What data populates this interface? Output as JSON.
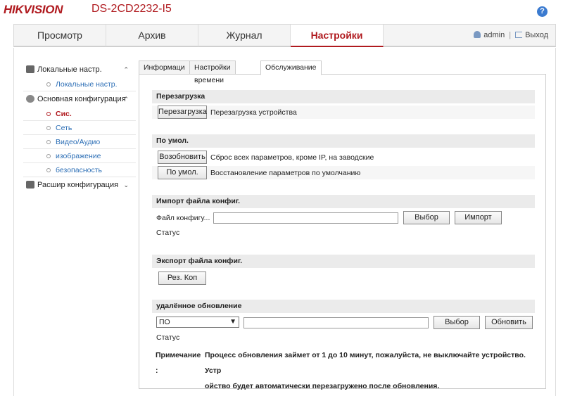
{
  "header": {
    "logo": "HIKVISION",
    "model": "DS-2CD2232-I5",
    "help": "?"
  },
  "nav": {
    "tabs": [
      "Просмотр",
      "Архив",
      "Журнал",
      "Настройки"
    ],
    "user": "admin",
    "logout": "Выход"
  },
  "sidebar": {
    "groups": [
      {
        "label": "Локальные настр.",
        "caret": "⌃",
        "items": [
          "Локальные настр."
        ]
      },
      {
        "label": "Основная конфигурация",
        "caret": "⌃",
        "items": [
          "Сис.",
          "Сеть",
          "Видео/Аудио",
          "изображение",
          "безопасность"
        ]
      },
      {
        "label": "Расшир конфигурация",
        "caret": "⌄"
      }
    ]
  },
  "tabs": [
    "Информаци",
    "Настройки времени",
    "Обслуживание"
  ],
  "reboot": {
    "title": "Перезагрузка",
    "button": "Перезагрузка",
    "desc": "Перезагрузка устройства"
  },
  "defaults": {
    "title": "По умол.",
    "restore_button": "Возобновить",
    "restore_desc": "Сброс всех параметров, кроме IP, на заводские",
    "default_button": "По умол.",
    "default_desc": "Восстановление параметров по умолчанию"
  },
  "import": {
    "title": "Импорт файла конфиг.",
    "file_label": "Файл конфигу...",
    "browse": "Выбор",
    "import_button": "Импорт",
    "status": "Статус"
  },
  "export": {
    "title": "Экспорт файла конфиг.",
    "button": "Рез. Коп"
  },
  "upgrade": {
    "title": "удалённое обновление",
    "select": "ПО",
    "browse": "Выбор",
    "upgrade_button": "Обновить",
    "status": "Статус",
    "note_label": "Примечание :",
    "note_line1": "Процесс обновления займет от 1 до 10 минут, пожалуйста, не выключайте устройство. Устр",
    "note_line2": "ойство будет автоматически перезагружено после обновления."
  }
}
